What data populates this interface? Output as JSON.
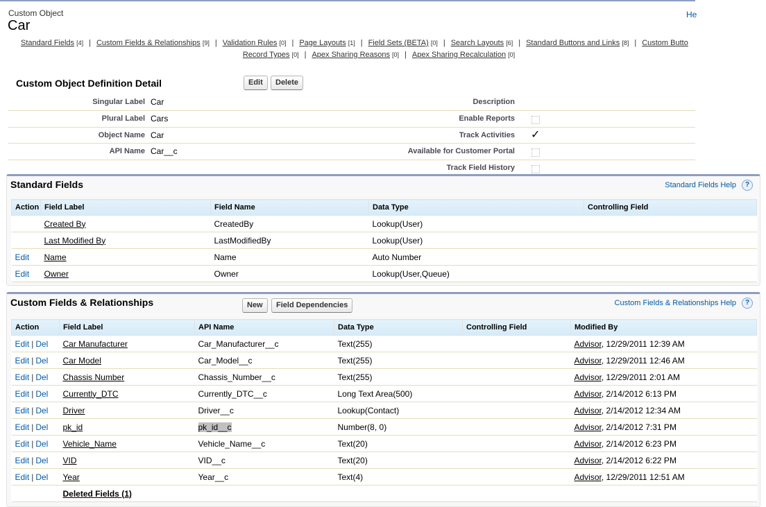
{
  "header": {
    "object_type": "Custom Object",
    "title": "Car",
    "help_link": "He"
  },
  "nav": {
    "row1": [
      {
        "label": "Standard Fields",
        "count": "[4]"
      },
      {
        "label": "Custom Fields & Relationships",
        "count": "[9]"
      },
      {
        "label": "Validation Rules",
        "count": "[0]"
      },
      {
        "label": "Page Layouts",
        "count": "[1]"
      },
      {
        "label": "Field Sets (BETA)",
        "count": "[0]"
      },
      {
        "label": "Search Layouts",
        "count": "[6]"
      },
      {
        "label": "Standard Buttons and Links",
        "count": "[8]"
      },
      {
        "label": "Custom Butto",
        "count": ""
      }
    ],
    "row2": [
      {
        "label": "Record Types",
        "count": "[0]"
      },
      {
        "label": "Apex Sharing Reasons",
        "count": "[0]"
      },
      {
        "label": "Apex Sharing Recalculation",
        "count": "[0]"
      }
    ],
    "separator": "|"
  },
  "detail": {
    "title": "Custom Object Definition Detail",
    "edit_label": "Edit",
    "delete_label": "Delete",
    "left": [
      {
        "label": "Singular Label",
        "value": "Car"
      },
      {
        "label": "Plural Label",
        "value": "Cars"
      },
      {
        "label": "Object Name",
        "value": "Car"
      },
      {
        "label": "API Name",
        "value": "Car__c"
      }
    ],
    "right": [
      {
        "label": "Description",
        "checkbox": "none"
      },
      {
        "label": "Enable Reports",
        "checkbox": "unchecked"
      },
      {
        "label": "Track Activities",
        "checkbox": "checked"
      },
      {
        "label": "Available for Customer Portal",
        "checkbox": "unchecked"
      },
      {
        "label": "Track Field History",
        "checkbox": "unchecked"
      }
    ],
    "checkmark_glyph": "✓"
  },
  "standard_fields": {
    "title": "Standard Fields",
    "help_label": "Standard Fields Help",
    "help_icon": "?",
    "columns": [
      "Action",
      "Field Label",
      "Field Name",
      "Data Type",
      "Controlling Field"
    ],
    "rows": [
      {
        "action": "",
        "label": "Created By",
        "name": "CreatedBy",
        "type": "Lookup(User)",
        "controlling": ""
      },
      {
        "action": "",
        "label": "Last Modified By",
        "name": "LastModifiedBy",
        "type": "Lookup(User)",
        "controlling": ""
      },
      {
        "action": "Edit",
        "label": "Name",
        "name": "Name",
        "type": "Auto Number",
        "controlling": ""
      },
      {
        "action": "Edit",
        "label": "Owner",
        "name": "Owner",
        "type": "Lookup(User,Queue)",
        "controlling": ""
      }
    ]
  },
  "custom_fields": {
    "title": "Custom Fields & Relationships",
    "new_label": "New",
    "deps_label": "Field Dependencies",
    "help_label": "Custom Fields & Relationships Help",
    "help_icon": "?",
    "columns": [
      "Action",
      "Field Label",
      "API Name",
      "Data Type",
      "Controlling Field",
      "Modified By"
    ],
    "edit_label": "Edit",
    "del_label": "Del",
    "action_sep": "|",
    "rows": [
      {
        "label": "Car Manufacturer",
        "api": "Car_Manufacturer__c",
        "type": "Text(255)",
        "controlling": "",
        "by": "Advisor",
        "date": ", 12/29/2011 12:39 AM"
      },
      {
        "label": "Car Model",
        "api": "Car_Model__c",
        "type": "Text(255)",
        "controlling": "",
        "by": "Advisor",
        "date": ", 12/29/2011 12:46 AM"
      },
      {
        "label": "Chassis Number",
        "api": "Chassis_Number__c",
        "type": "Text(255)",
        "controlling": "",
        "by": "Advisor",
        "date": ", 12/29/2011 2:01 AM"
      },
      {
        "label": "Currently_DTC",
        "api": "Currently_DTC__c",
        "type": "Long Text Area(500)",
        "controlling": "",
        "by": "Advisor",
        "date": ", 2/14/2012 6:13 PM"
      },
      {
        "label": "Driver",
        "api": "Driver__c",
        "type": "Lookup(Contact)",
        "controlling": "",
        "by": "Advisor",
        "date": ", 2/14/2012 12:34 AM"
      },
      {
        "label": "pk_id",
        "api": "pk_id__c",
        "type": "Number(8, 0)",
        "controlling": "",
        "by": "Advisor",
        "date": ", 2/14/2012 7:31 PM"
      },
      {
        "label": "Vehicle_Name",
        "api": "Vehicle_Name__c",
        "type": "Text(20)",
        "controlling": "",
        "by": "Advisor",
        "date": ", 2/14/2012 6:23 PM"
      },
      {
        "label": "VID",
        "api": "VID__c",
        "type": "Text(20)",
        "controlling": "",
        "by": "Advisor",
        "date": ", 2/14/2012 6:22 PM"
      },
      {
        "label": "Year",
        "api": "Year__c",
        "type": "Text(4)",
        "controlling": "",
        "by": "Advisor",
        "date": ", 12/29/2011 12:51 AM"
      }
    ],
    "deleted_label": "Deleted Fields (1)"
  }
}
